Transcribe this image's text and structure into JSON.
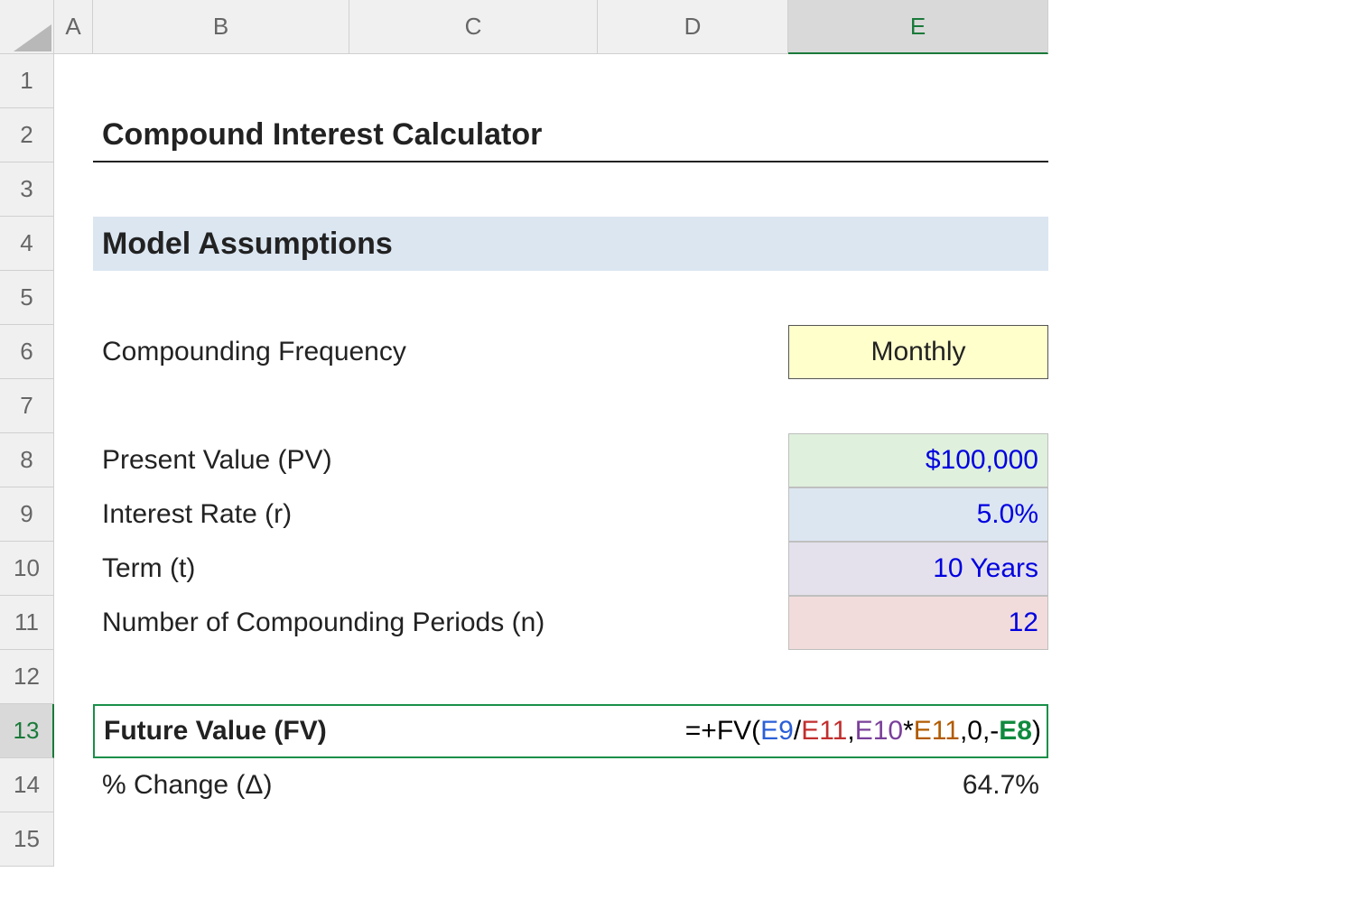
{
  "columns": [
    "A",
    "B",
    "C",
    "D",
    "E"
  ],
  "rows": [
    "1",
    "2",
    "3",
    "4",
    "5",
    "6",
    "7",
    "8",
    "9",
    "10",
    "11",
    "12",
    "13",
    "14",
    "15"
  ],
  "active_cell": "E13",
  "content": {
    "title": "Compound Interest Calculator",
    "section": "Model Assumptions",
    "labels": {
      "freq": "Compounding Frequency",
      "pv": "Present Value (PV)",
      "rate": "Interest Rate (r)",
      "term": "Term (t)",
      "periods": "Number of Compounding Periods (n)",
      "fv": "Future Value (FV)",
      "change": "% Change (Δ)"
    },
    "values": {
      "freq": "Monthly",
      "pv": "$100,000",
      "rate": "5.0%",
      "term": "10 Years",
      "periods": "12",
      "change": "64.7%"
    },
    "formula": {
      "prefix": "=+FV(",
      "ref1": "E9",
      "sep1": "/",
      "ref2": "E11",
      "sep2": ",",
      "ref3": "E10",
      "sep3": "*",
      "ref4": "E11",
      "sep4": ",0,-",
      "ref5": "E8",
      "suffix": ")"
    }
  }
}
